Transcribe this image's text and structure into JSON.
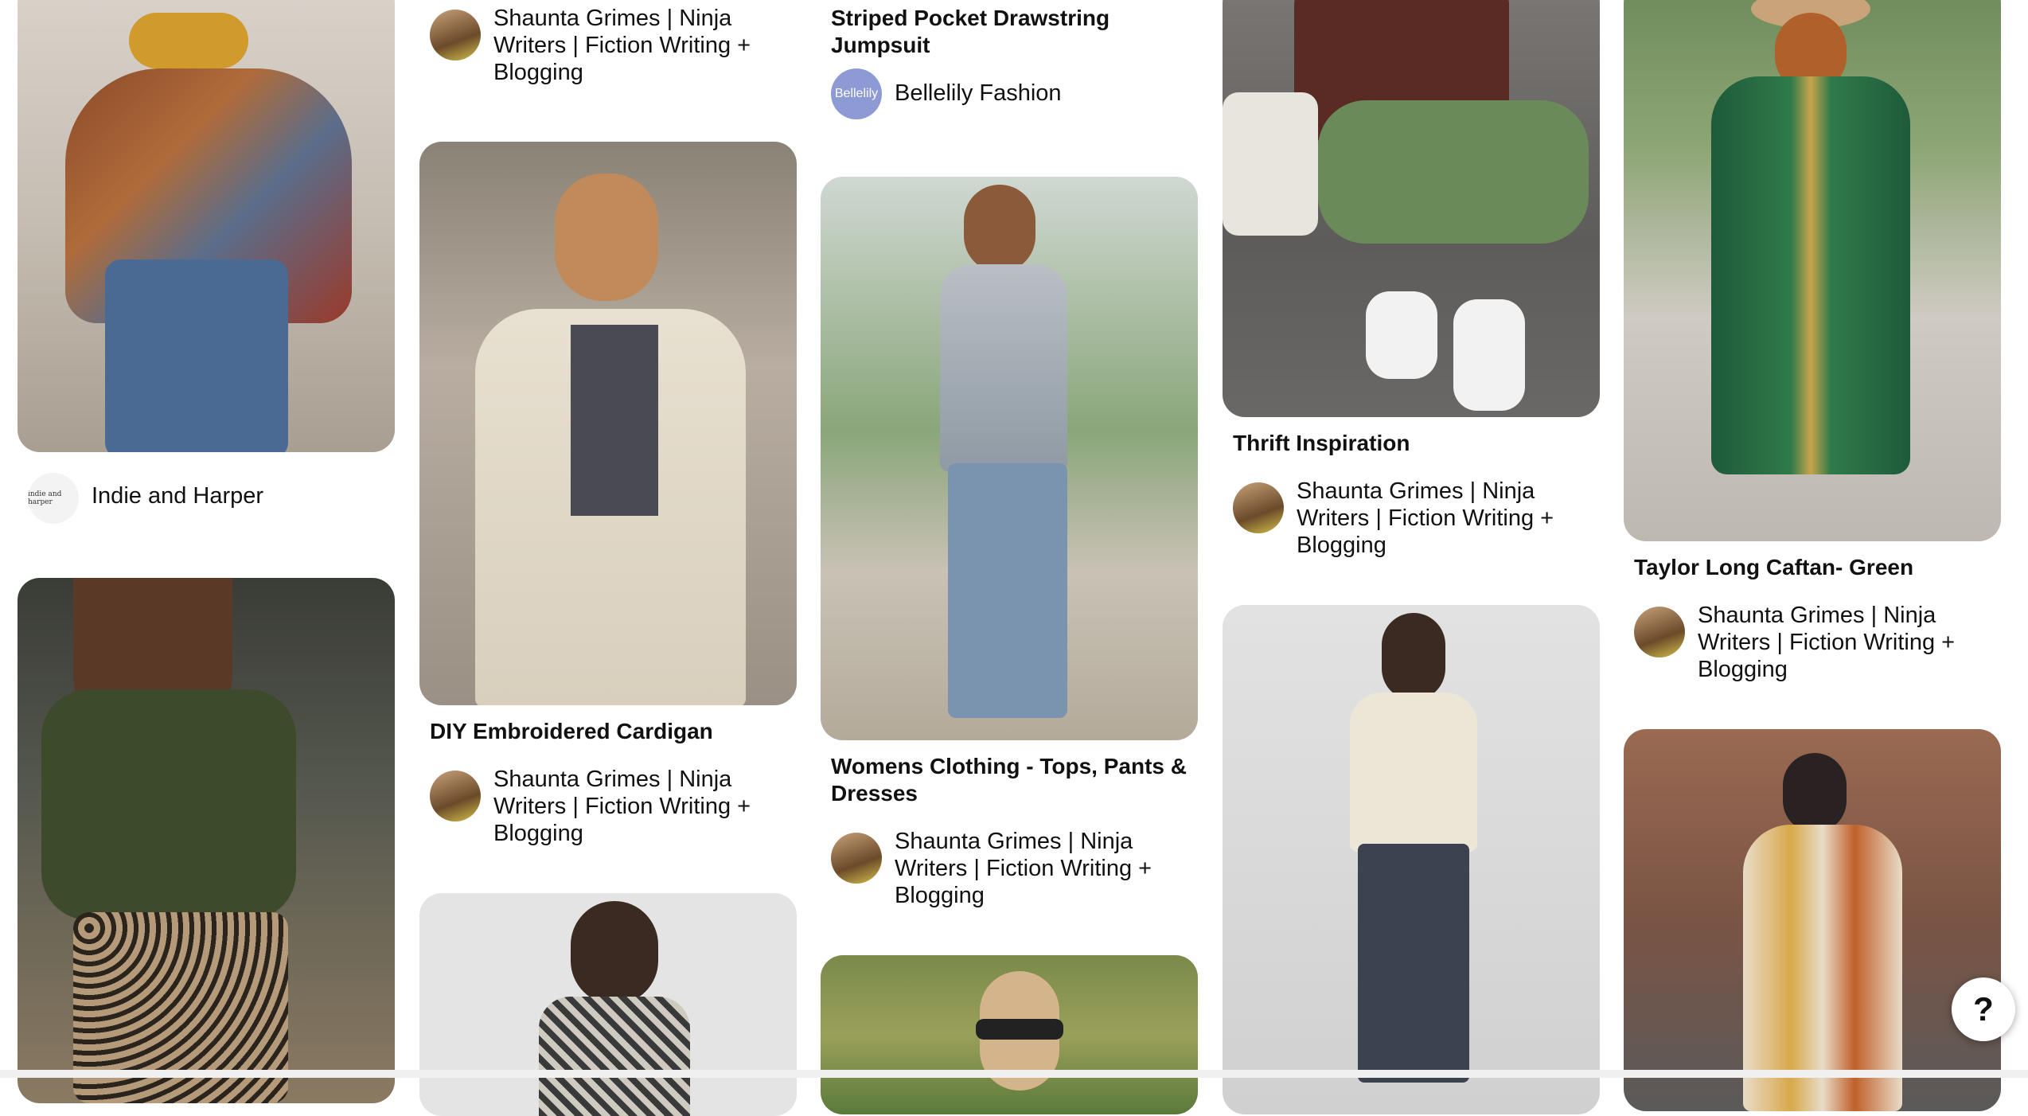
{
  "pins": {
    "c1a": {
      "source": "Indie and Harper",
      "avatar_text": "indie and harper"
    },
    "c2a": {
      "source": "Shaunta Grimes | Ninja Writers | Fiction Writing + Blogging"
    },
    "c2b": {
      "title": "DIY Embroidered Cardigan",
      "source": "Shaunta Grimes | Ninja Writers | Fiction Writing + Blogging"
    },
    "c3a": {
      "title": "Striped Pocket Drawstring Jumpsuit",
      "source": "Bellelily Fashion",
      "avatar_text": "Bellelily"
    },
    "c3b": {
      "title": "Womens Clothing - Tops, Pants & Dresses",
      "source": "Shaunta Grimes | Ninja Writers | Fiction Writing + Blogging"
    },
    "c4a": {
      "title": "Thrift Inspiration",
      "source": "Shaunta Grimes | Ninja Writers | Fiction Writing + Blogging"
    },
    "c5a": {
      "title": "Taylor Long Caftan- Green",
      "source": "Shaunta Grimes | Ninja Writers | Fiction Writing + Blogging"
    }
  },
  "help_button": {
    "label": "?"
  },
  "colors": {
    "page_bg": "#ffffff",
    "text": "#111111",
    "bellelily_avatar": "#8e9ad4"
  }
}
